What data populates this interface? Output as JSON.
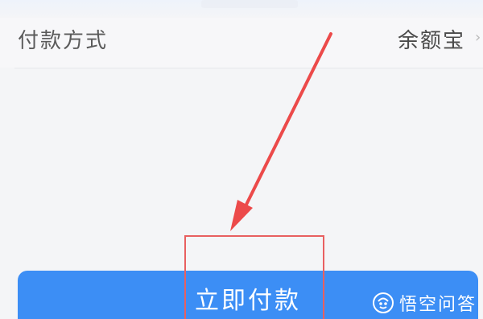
{
  "payment": {
    "label": "付款方式",
    "value": "余额宝"
  },
  "actions": {
    "pay_now": "立即付款"
  },
  "watermark": {
    "text": "悟空问答"
  },
  "colors": {
    "button": "#3c8ef5",
    "annotation": "#e86060"
  }
}
